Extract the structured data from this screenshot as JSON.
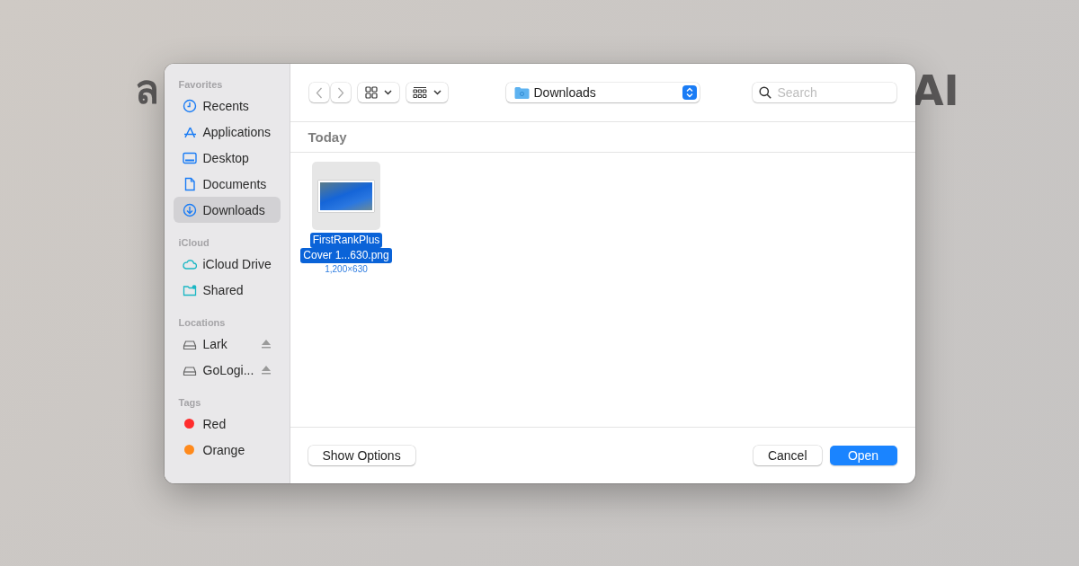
{
  "background_text": [
    "ล",
    "AI"
  ],
  "sidebar": {
    "sections": [
      {
        "title": "Favorites",
        "items": [
          {
            "label": "Recents",
            "selected": false
          },
          {
            "label": "Applications",
            "selected": false
          },
          {
            "label": "Desktop",
            "selected": false
          },
          {
            "label": "Documents",
            "selected": false
          },
          {
            "label": "Downloads",
            "selected": true
          }
        ]
      },
      {
        "title": "iCloud",
        "items": [
          {
            "label": "iCloud Drive",
            "selected": false
          },
          {
            "label": "Shared",
            "selected": false
          }
        ]
      },
      {
        "title": "Locations",
        "items": [
          {
            "label": "Lark",
            "selected": false
          },
          {
            "label": "GoLogi...",
            "selected": false
          }
        ]
      },
      {
        "title": "Tags",
        "items": [
          {
            "label": "Red",
            "color": "#ff2d2d",
            "selected": false
          },
          {
            "label": "Orange",
            "color": "#ff8a1c",
            "selected": false
          }
        ]
      }
    ]
  },
  "toolbar": {
    "location": "Downloads",
    "search": {
      "placeholder": "Search"
    }
  },
  "group_header": "Today",
  "files": [
    {
      "name_lines": [
        "FirstRankPlus",
        "Cover 1...630.png"
      ],
      "dimensions": "1,200×630",
      "selected": true
    }
  ],
  "buttons": [
    {
      "label": "Show Options",
      "kind": "secondary"
    },
    {
      "label": "Cancel",
      "kind": "secondary"
    },
    {
      "label": "Open",
      "kind": "primary"
    }
  ]
}
